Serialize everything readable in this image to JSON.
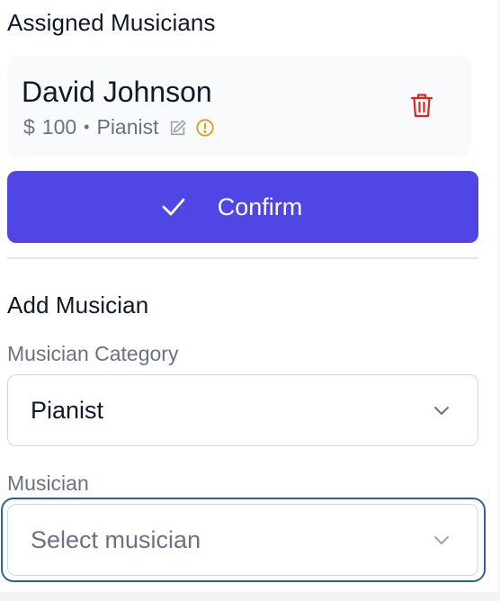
{
  "assigned": {
    "title": "Assigned Musicians",
    "musician": {
      "name": "David Johnson",
      "currency": "$",
      "amount": "100",
      "separator": "•",
      "role": "Pianist"
    },
    "icons": {
      "edit": "edit-icon",
      "warning": "warning-icon",
      "delete": "trash-icon"
    }
  },
  "confirm": {
    "label": "Confirm",
    "icon": "check-icon"
  },
  "add": {
    "title": "Add Musician",
    "category_label": "Musician Category",
    "category_value": "Pianist",
    "musician_label": "Musician",
    "musician_placeholder": "Select musician"
  },
  "colors": {
    "accent": "#4f46e5",
    "danger": "#dc2626",
    "warning": "#d4a017",
    "focus": "#2e5ea6",
    "muted": "#6b7280"
  }
}
